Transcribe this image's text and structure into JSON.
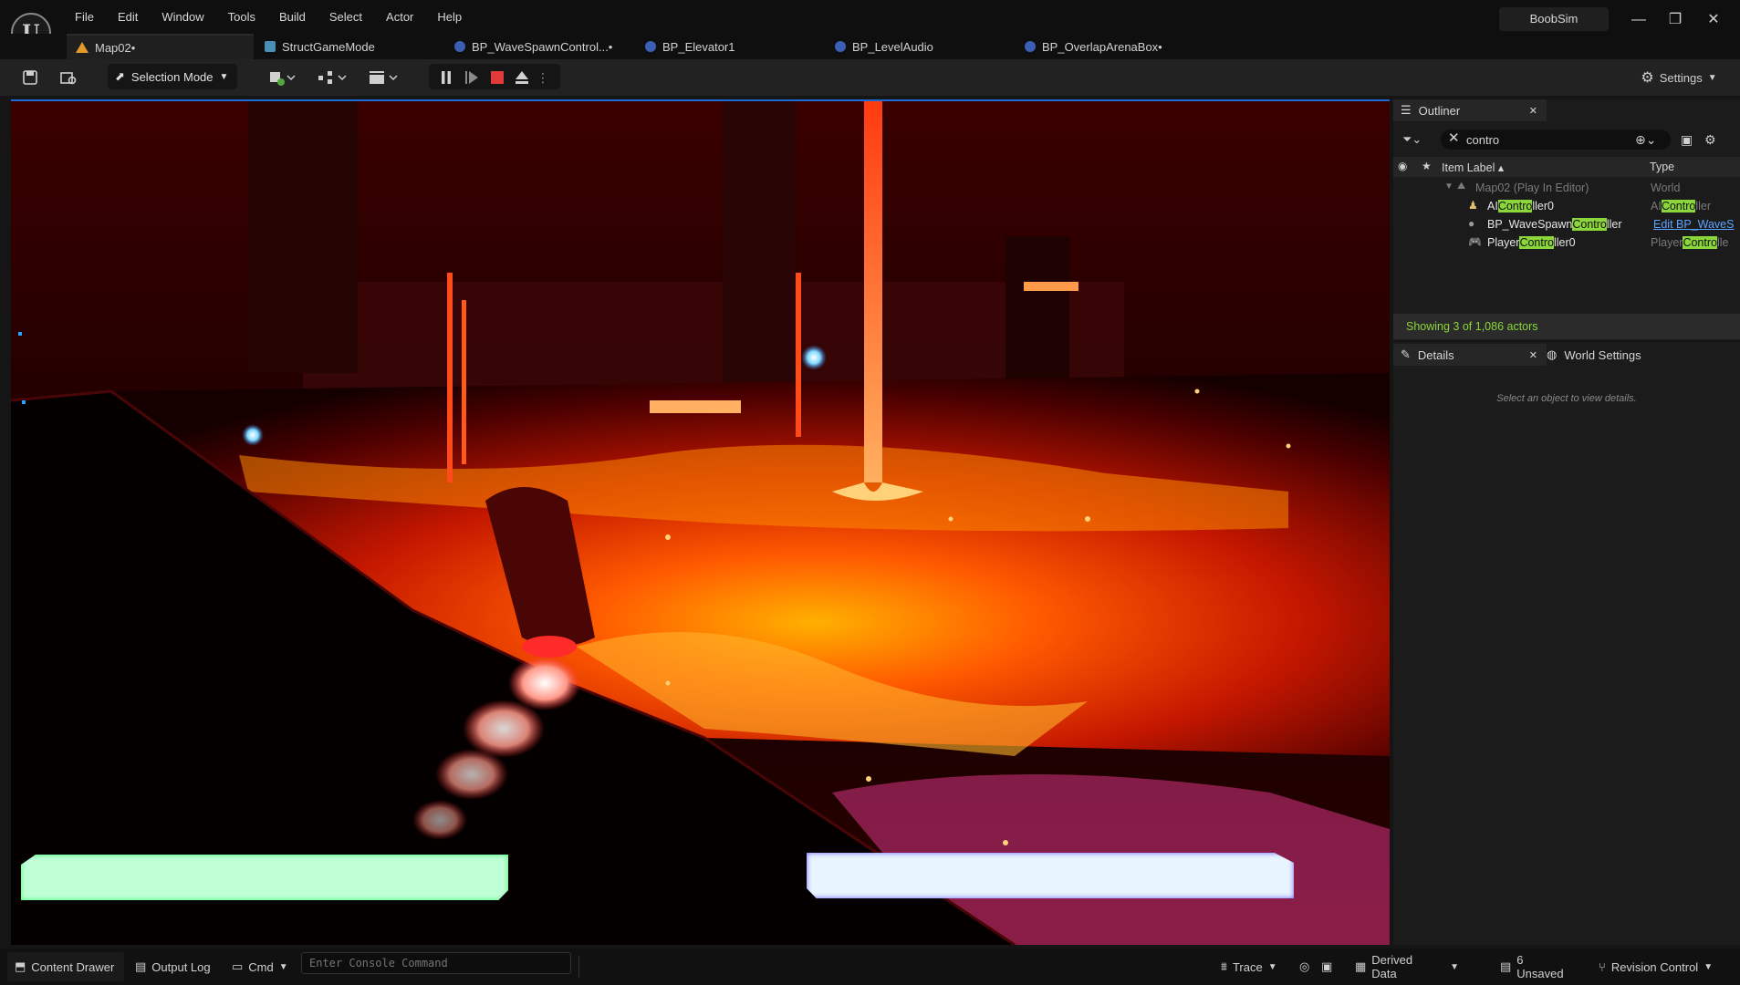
{
  "menu": [
    "File",
    "Edit",
    "Window",
    "Tools",
    "Build",
    "Select",
    "Actor",
    "Help"
  ],
  "project_name": "BoobSim",
  "window_controls": {
    "minimize": "—",
    "maximize": "❐",
    "close": "✕"
  },
  "tabs": [
    {
      "label": "Map02•",
      "icon": "map-icon",
      "active": true
    },
    {
      "label": "StructGameMode",
      "icon": "gamemode-icon",
      "active": false
    },
    {
      "label": "BP_WaveSpawnControl...•",
      "icon": "blueprint-icon",
      "active": false
    },
    {
      "label": "BP_Elevator1",
      "icon": "blueprint-icon",
      "active": false
    },
    {
      "label": "BP_LevelAudio",
      "icon": "blueprint-icon",
      "active": false
    },
    {
      "label": "BP_OverlapArenaBox•",
      "icon": "blueprint-icon",
      "active": false
    }
  ],
  "toolbar": {
    "selection_mode": "Selection Mode",
    "settings": "Settings"
  },
  "outliner": {
    "tab_label": "Outliner",
    "search_value": "contro",
    "columns": {
      "label": "Item Label",
      "type": "Type"
    },
    "world_row": {
      "label": "Map02 (Play In Editor)",
      "type": "World"
    },
    "items": [
      {
        "pre": "AI",
        "match": "Contro",
        "post": "ller0",
        "type_pre": "AI",
        "type_match": "Contro",
        "type_post": "ller"
      },
      {
        "pre": "BP_WaveSpawn",
        "match": "Contro",
        "post": "ller",
        "type_link": "Edit BP_WaveS"
      },
      {
        "pre": "Player",
        "match": "Contro",
        "post": "ller0",
        "type_pre": "Player",
        "type_match": "Contro",
        "type_post": "lle"
      }
    ],
    "status": "Showing 3 of 1,086 actors"
  },
  "details": {
    "tab_label": "Details",
    "world_settings_tab": "World Settings",
    "empty_message": "Select an object to view details."
  },
  "bottombar": {
    "content_drawer": "Content Drawer",
    "output_log": "Output Log",
    "cmd": "Cmd",
    "console_placeholder": "Enter Console Command",
    "trace": "Trace",
    "derived_data": "Derived Data",
    "unsaved": "6 Unsaved",
    "revision_control": "Revision Control"
  },
  "colors": {
    "accent": "#1a6bd6",
    "search_highlight": "#8bd63a",
    "lava": "#ff5a00",
    "hud_green": "#bfffd6",
    "hud_blue": "#e8f4ff"
  }
}
